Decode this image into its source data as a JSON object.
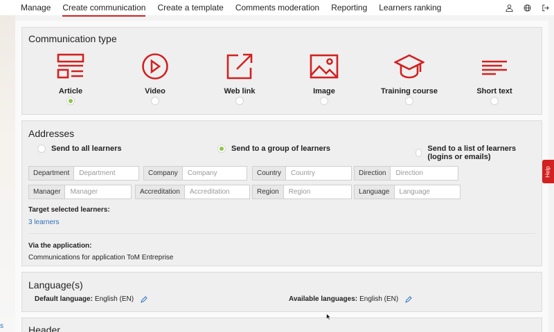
{
  "nav": {
    "items": [
      {
        "label": "Manage"
      },
      {
        "label": "Create communication"
      },
      {
        "label": "Create a template"
      },
      {
        "label": "Comments moderation"
      },
      {
        "label": "Reporting"
      },
      {
        "label": "Learners ranking"
      }
    ],
    "active_index": 1,
    "icons": [
      "user-icon",
      "globe-icon",
      "logout-icon"
    ]
  },
  "comm_type": {
    "title": "Communication type",
    "types": [
      {
        "label": "Article",
        "icon": "article-icon",
        "selected": true
      },
      {
        "label": "Video",
        "icon": "video-icon",
        "selected": false
      },
      {
        "label": "Web link",
        "icon": "external-link-icon",
        "selected": false
      },
      {
        "label": "Image",
        "icon": "image-icon",
        "selected": false
      },
      {
        "label": "Training course",
        "icon": "graduation-cap-icon",
        "selected": false
      },
      {
        "label": "Short text",
        "icon": "short-text-icon",
        "selected": false
      }
    ]
  },
  "addresses": {
    "title": "Addresses",
    "send_options": [
      {
        "label": "Send to all learners",
        "selected": false
      },
      {
        "label": "Send to a group of learners",
        "selected": true
      },
      {
        "label": "Send to a list of learners (logins or emails)",
        "selected": false
      }
    ],
    "filters": [
      {
        "label": "Department",
        "placeholder": "Department"
      },
      {
        "label": "Company",
        "placeholder": "Company"
      },
      {
        "label": "Country",
        "placeholder": "Country"
      },
      {
        "label": "Direction",
        "placeholder": "Direction"
      },
      {
        "label": "Manager",
        "placeholder": "Manager"
      },
      {
        "label": "Accreditation",
        "placeholder": "Accreditation"
      },
      {
        "label": "Region",
        "placeholder": "Region"
      },
      {
        "label": "Language",
        "placeholder": "Language"
      }
    ],
    "target_label": "Target selected learners:",
    "target_value": "3 learners",
    "via_label": "Via the application:",
    "via_value": "Communications for application ToM Entreprise"
  },
  "languages": {
    "title": "Language(s)",
    "default_label": "Default language:",
    "default_value": "English (EN)",
    "available_label": "Available languages:",
    "available_value": "English (EN)"
  },
  "header_panel": {
    "title": "Header"
  },
  "help": {
    "label": "Help"
  },
  "side": {
    "link": "s"
  },
  "colors": {
    "accent_red": "#d32020",
    "selected_green": "#8ec63f",
    "link_blue": "#2a6fb8"
  }
}
